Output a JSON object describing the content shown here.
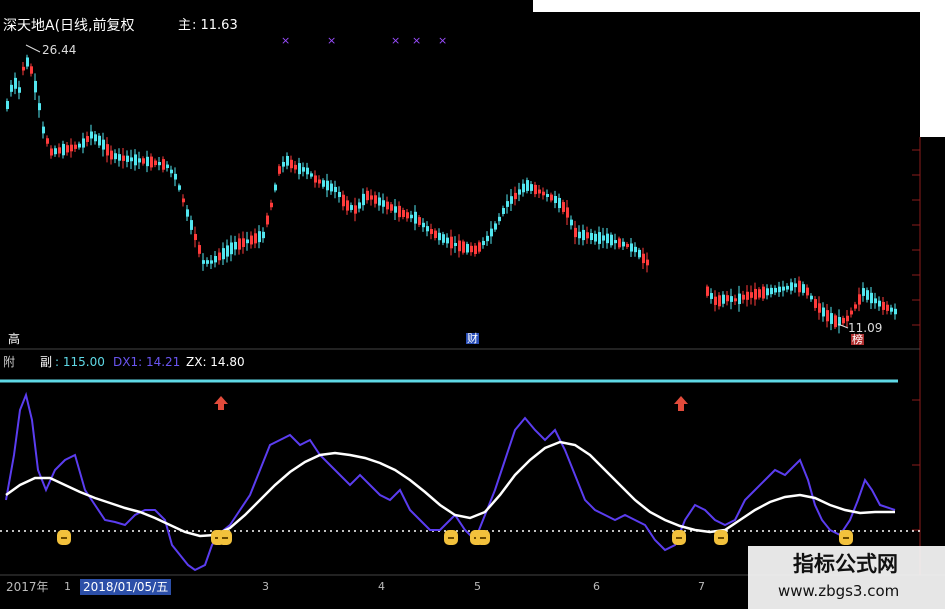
{
  "main_panel": {
    "title": "深天地A(日线,前复权",
    "price_label_prefix": "主",
    "price_value": ": 11.63",
    "high_marker": "26.44",
    "low_marker": "11.09",
    "high_tag": "高",
    "fin_tag": "财",
    "bang_tag": "榜"
  },
  "sub_panel": {
    "name_prefix": "附",
    "label": "副",
    "v1": ": 115.00",
    "dx1": "DX1: 14.21",
    "zx": "ZX: 14.80"
  },
  "time_axis": {
    "year_label": "2017年",
    "selected_date": "2018/01/05/五",
    "months": [
      "1",
      "3",
      "4",
      "5",
      "6",
      "7"
    ]
  },
  "watermark": {
    "title": "指标公式网",
    "url": "www.zbgs3.com"
  },
  "colors": {
    "up_candle": "#ff3b3b",
    "down_candle": "#52e6ef",
    "indicator_blue": "#5b3df0",
    "indicator_white": "#ffffff",
    "signal_yellow": "#f2c13c",
    "cyan_line": "#5fd9e6"
  },
  "icons": [
    "up-arrow-icon",
    "signal-dot-icon",
    "purple-x-icon"
  ]
}
